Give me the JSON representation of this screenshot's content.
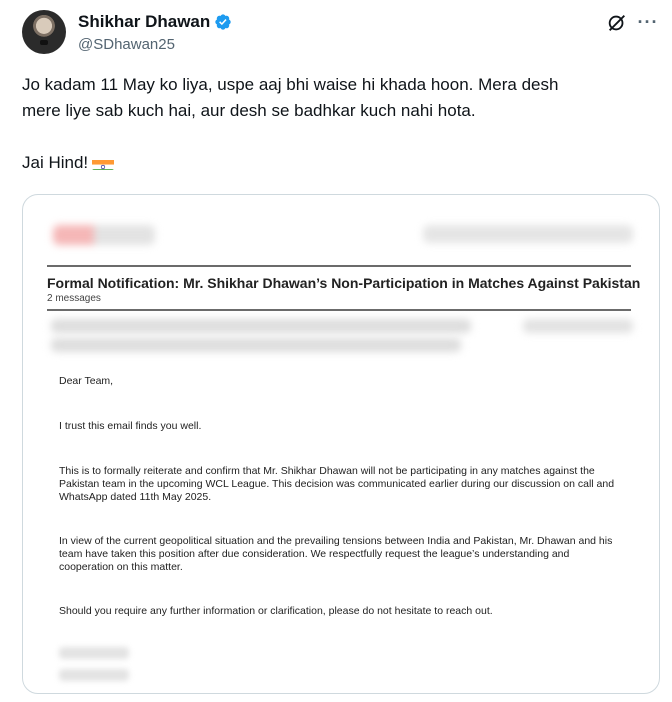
{
  "author": {
    "name": "Shikhar Dhawan",
    "handle": "@SDhawan25",
    "verified_icon": "verified-badge-icon",
    "avatar_icon": "profile-photo"
  },
  "toolbar": {
    "grok_icon": "grok-icon",
    "more_icon": "more-icon"
  },
  "tweet": {
    "line1": "Jo kadam 11 May ko liya, uspe aaj bhi waise hi khada hoon. Mera desh",
    "line2": "mere liye sab kuch hai, aur desh se badhkar kuch nahi hota.",
    "line3": "Jai Hind!",
    "flag_icon": "india-flag-icon"
  },
  "attachment": {
    "subject": "Formal Notification: Mr. Shikhar Dhawan’s Non-Participation in Matches Against Pakistan",
    "message_count": "2 messages",
    "greeting": "Dear Team,",
    "para1": "I trust this email finds you well.",
    "para2_l1": "This is to formally reiterate and confirm that Mr. Shikhar Dhawan will not be participating in any matches against the",
    "para2_l2": "Pakistan team in the upcoming WCL League. This decision was communicated earlier during our discussion on call and",
    "para2_l3": "WhatsApp dated 11th May 2025.",
    "para3_l1": "In view of the current geopolitical situation and the prevailing tensions between India and Pakistan, Mr. Dhawan and his",
    "para3_l2": "team have taken this position after due consideration. We respectfully request the league’s understanding and",
    "para3_l3": "cooperation on this matter.",
    "para4": "Should you require any further information or clarification, please do not hesitate to reach out."
  },
  "colors": {
    "verified": "#1d9bf0",
    "text": "#0f1419",
    "secondary": "#536471",
    "card_border": "#cfd9de"
  }
}
